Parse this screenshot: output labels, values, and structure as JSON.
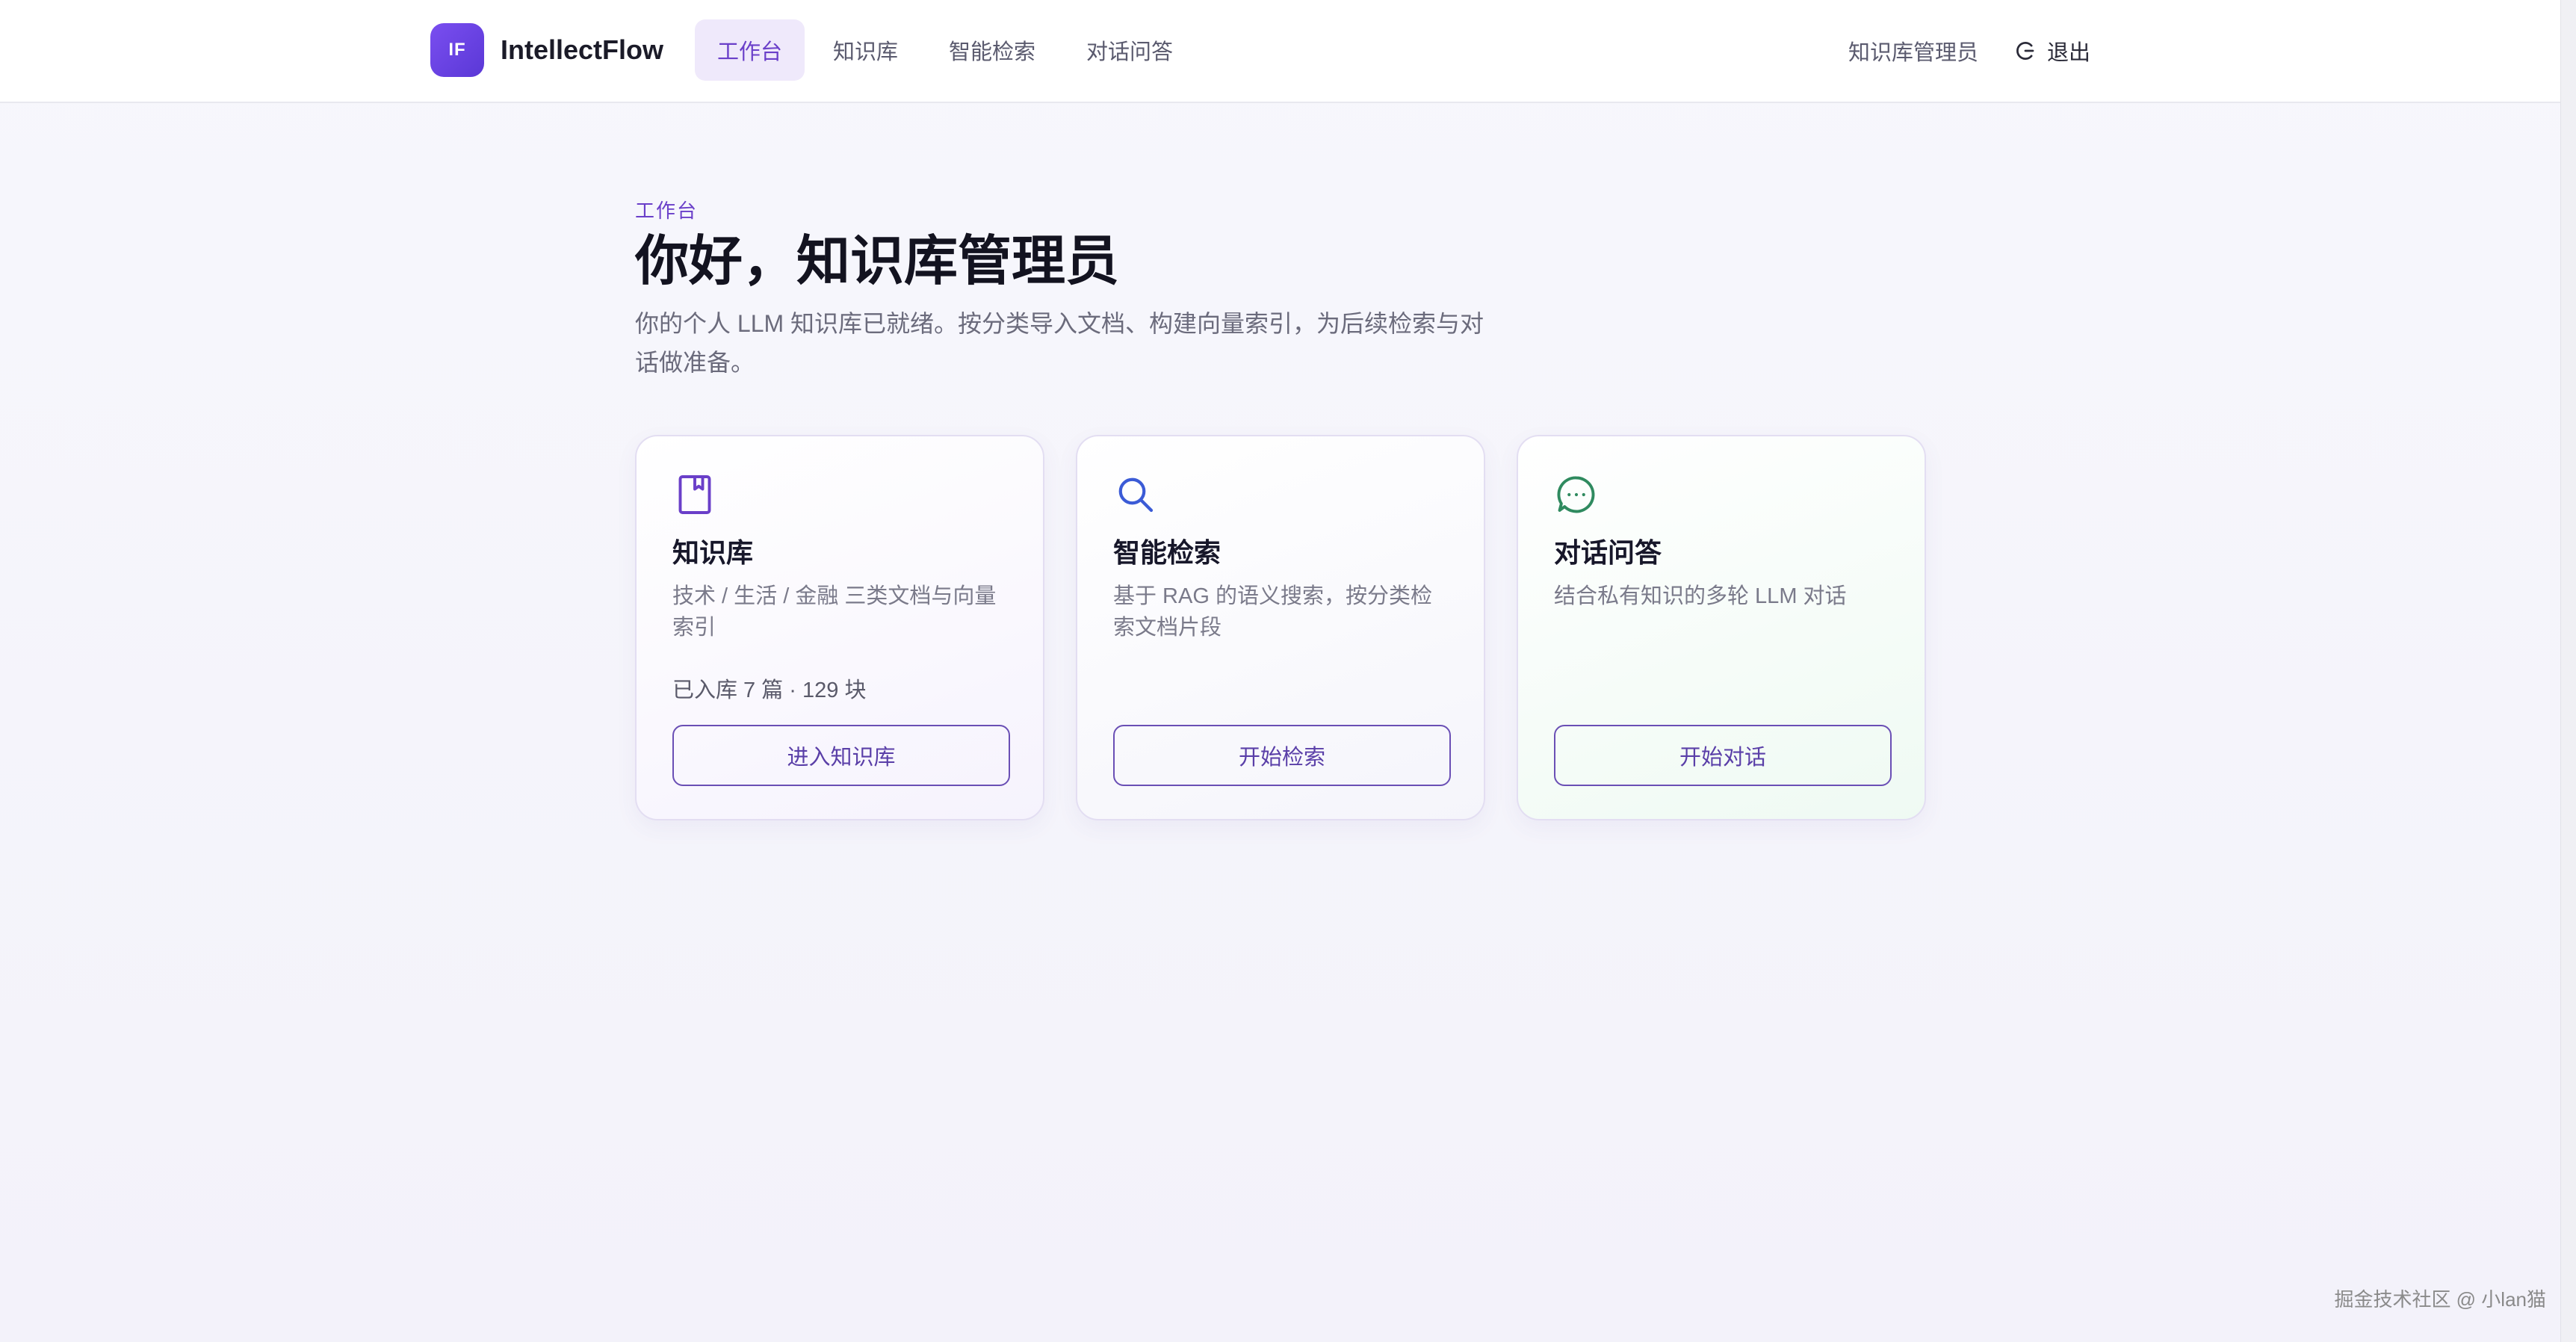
{
  "brand": {
    "logo_text": "IF",
    "name": "IntellectFlow",
    "accent": "#6a3fc9"
  },
  "nav": {
    "items": [
      {
        "label": "工作台",
        "active": true
      },
      {
        "label": "知识库",
        "active": false
      },
      {
        "label": "智能检索",
        "active": false
      },
      {
        "label": "对话问答",
        "active": false
      }
    ]
  },
  "user": {
    "name": "知识库管理员",
    "logout_label": "退出",
    "logout_icon": "logout-icon"
  },
  "hero": {
    "eyebrow": "工作台",
    "title": "你好，知识库管理员",
    "subtitle": "你的个人 LLM 知识库已就绪。按分类导入文档、构建向量索引，为后续检索与对话做准备。"
  },
  "cards": [
    {
      "icon": "book-icon",
      "icon_color": "#6a3fc9",
      "title": "知识库",
      "desc": "技术 / 生活 / 金融 三类文档与向量索引",
      "meta": "已入库 7 篇 · 129 块",
      "button": "进入知识库"
    },
    {
      "icon": "search-icon",
      "icon_color": "#3b5bd6",
      "title": "智能检索",
      "desc": "基于 RAG 的语义搜索，按分类检索文档片段",
      "meta": "",
      "button": "开始检索"
    },
    {
      "icon": "chat-icon",
      "icon_color": "#2f8a5f",
      "title": "对话问答",
      "desc": "结合私有知识的多轮 LLM 对话",
      "meta": "",
      "button": "开始对话"
    }
  ],
  "watermark": "掘金技术社区 @ 小lan猫"
}
